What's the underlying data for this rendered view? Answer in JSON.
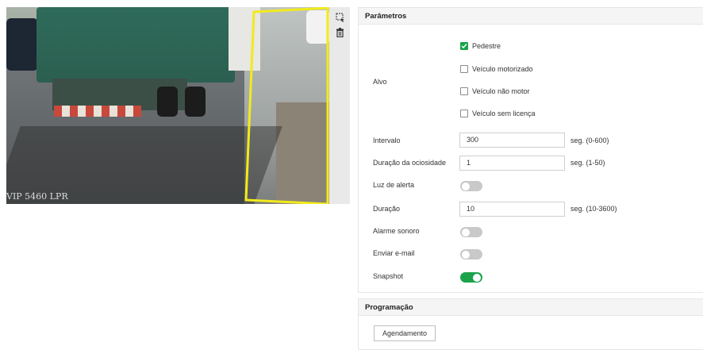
{
  "video": {
    "osd_text": "VIP 5460 LPR",
    "roi_color": "#f2ea1b"
  },
  "toolbar": {
    "icons": [
      "select-area-icon",
      "delete-icon"
    ]
  },
  "params": {
    "title": "Parâmetros",
    "target_label": "Alvo",
    "targets": [
      {
        "label": "Pedestre",
        "checked": true
      },
      {
        "label": "Veículo motorizado",
        "checked": false
      },
      {
        "label": "Veículo não motor",
        "checked": false
      },
      {
        "label": "Veículo sem licença",
        "checked": false
      }
    ],
    "interval": {
      "label": "Intervalo",
      "value": "300",
      "unit": "seg. (0-600)"
    },
    "idle_duration": {
      "label": "Duração da ociosidade",
      "value": "1",
      "unit": "seg. (1-50)"
    },
    "warning_light": {
      "label": "Luz de alerta",
      "on": false
    },
    "duration": {
      "label": "Duração",
      "value": "10",
      "unit": "seg. (10-3600)"
    },
    "sound_alarm": {
      "label": "Alarme sonoro",
      "on": false
    },
    "send_email": {
      "label": "Enviar e-mail",
      "on": false
    },
    "snapshot": {
      "label": "Snapshot",
      "on": true
    }
  },
  "schedule": {
    "title": "Programação",
    "button_label": "Agendamento"
  },
  "colors": {
    "accent": "#1aa34a",
    "toggle_off": "#c9c9c9",
    "header_bg": "#f5f5f5"
  }
}
